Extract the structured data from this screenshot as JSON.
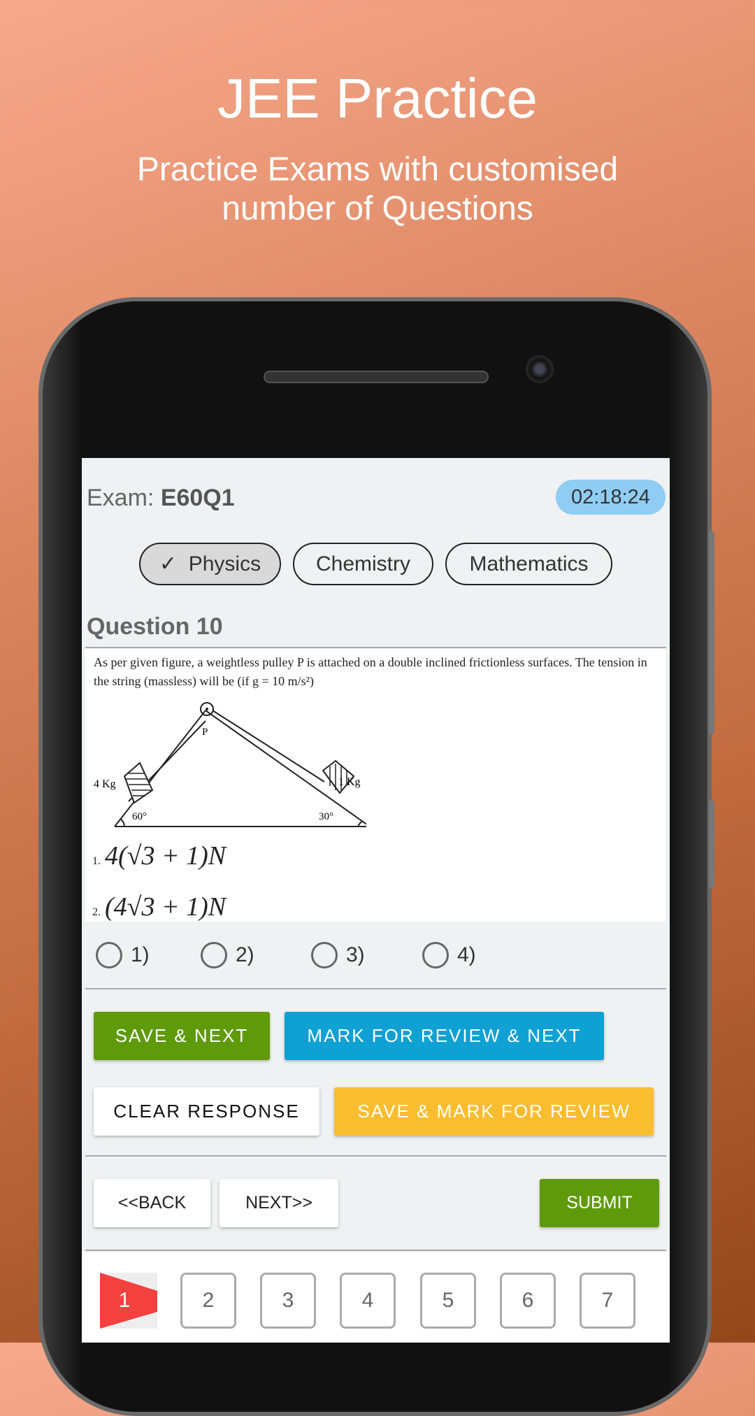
{
  "hero": {
    "title": "JEE Practice",
    "subtitle": "Practice Exams with customised number of Questions"
  },
  "exam": {
    "label": "Exam:",
    "code": "E60Q1",
    "timer": "02:18:24"
  },
  "tabs": [
    {
      "label": "Physics",
      "selected": true
    },
    {
      "label": "Chemistry",
      "selected": false
    },
    {
      "label": "Mathematics",
      "selected": false
    }
  ],
  "question": {
    "title": "Question 10",
    "text": "As per given figure, a weightless pulley P is attached on a double inclined frictionless surfaces. The tension in the string (massless) will be (if g = 10 m/s²)",
    "figure": {
      "pulley": "P",
      "left_mass": "4 Kg",
      "right_mass": "1 Kg",
      "left_angle": "60°",
      "right_angle": "30°"
    },
    "options": [
      {
        "num": "1.",
        "expr": "4(√3 + 1)N"
      },
      {
        "num": "2.",
        "expr": "(4√3 + 1)N"
      }
    ]
  },
  "answers": [
    "1)",
    "2)",
    "3)",
    "4)"
  ],
  "actions": {
    "save_next": "SAVE & NEXT",
    "mark_review_next": "MARK FOR REVIEW & NEXT",
    "clear": "CLEAR RESPONSE",
    "save_mark": "SAVE & MARK FOR REVIEW",
    "back": "<<BACK",
    "next": "NEXT>>",
    "submit": "SUBMIT"
  },
  "palette": {
    "current": "1",
    "items": [
      "2",
      "3",
      "4",
      "5",
      "6",
      "7"
    ]
  },
  "colors": {
    "green": "#5f9a0a",
    "blue": "#0fa0d4",
    "yellow": "#fbbd30",
    "timer": "#8fcdf5",
    "current": "#f54040"
  }
}
